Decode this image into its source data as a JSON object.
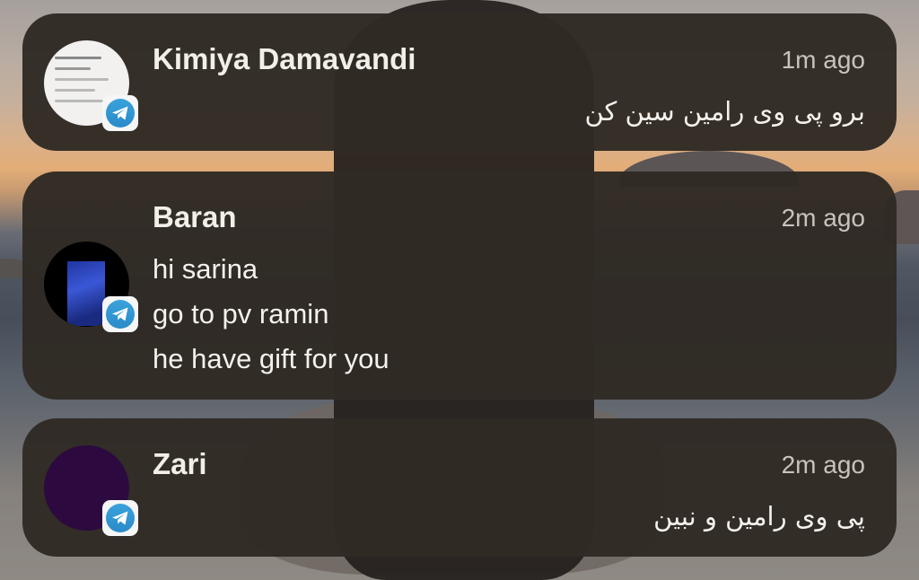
{
  "notifications": [
    {
      "sender": "Kimiya Damavandi",
      "time": "1m ago",
      "message": "برو پی وی رامین سین کن",
      "app_icon": "telegram-icon"
    },
    {
      "sender": "Baran",
      "time": "2m ago",
      "message_lines": [
        "hi sarina",
        "go to pv ramin",
        "he have gift for you"
      ],
      "app_icon": "telegram-icon"
    },
    {
      "sender": "Zari",
      "time": "2m ago",
      "message": "پی وی رامین و نبین",
      "app_icon": "telegram-icon"
    }
  ],
  "colors": {
    "card_bg": "#2f2a24",
    "telegram_blue": "#2a8bc8"
  }
}
